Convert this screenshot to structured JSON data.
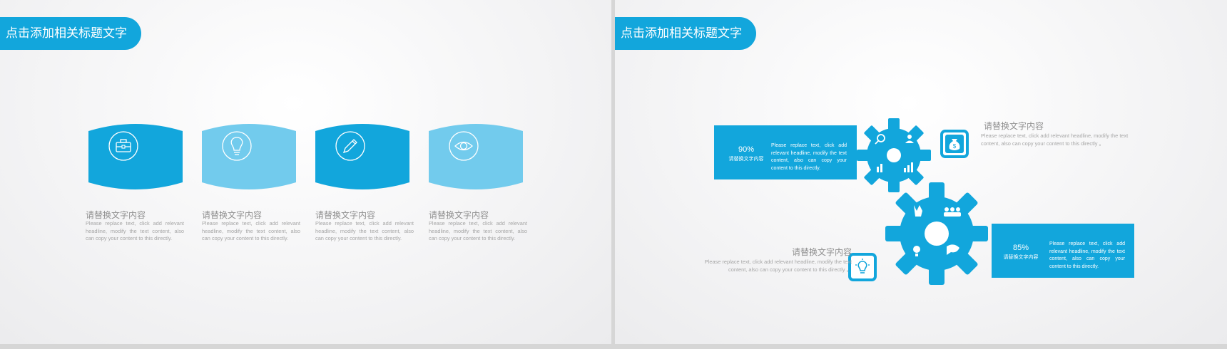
{
  "colors": {
    "accent": "#12a6dc",
    "light": "#72cbed",
    "text_gray": "#8f8f8f"
  },
  "slide1": {
    "title": "点击添加相关标题文字",
    "items": [
      {
        "icon": "briefcase-icon",
        "color": "#12a6dc",
        "heading": "请替换文字内容",
        "body": "Please replace text, click add relevant headline, modify the text content, also can copy your content to this directly."
      },
      {
        "icon": "lightbulb-icon",
        "color": "#72cbed",
        "heading": "请替换文字内容",
        "body": "Please replace text, click add relevant headline, modify the text content, also can copy your content to this directly."
      },
      {
        "icon": "pencil-icon",
        "color": "#12a6dc",
        "heading": "请替换文字内容",
        "body": "Please replace text, click add relevant headline, modify the text content, also can copy your content to this directly."
      },
      {
        "icon": "eye-icon",
        "color": "#72cbed",
        "heading": "请替换文字内容",
        "body": "Please replace text, click add relevant headline, modify the text content, also can copy your content to this directly."
      }
    ]
  },
  "slide2": {
    "title": "点击添加相关标题文字",
    "box1": {
      "percent": "90%",
      "label": "请替换文字内容",
      "text": "Please replace text, click add relevant headline, modify the text content, also can copy your content to this directly."
    },
    "box2": {
      "percent": "85%",
      "label": "请替换文字内容",
      "text": "Please replace text, click add relevant headline, modify the text content, also can copy your content to this directly."
    },
    "side1": {
      "heading": "请替换文字内容",
      "text": "Please replace text, click add relevant headline, modify the text content, also can copy your content to this directly 。",
      "icon": "money-bag-icon"
    },
    "side2": {
      "heading": "请替换文字内容",
      "text": "Please replace text, click add relevant headline, modify the text content, also can copy your content to this directly 。",
      "icon": "lightbulb-icon"
    }
  }
}
